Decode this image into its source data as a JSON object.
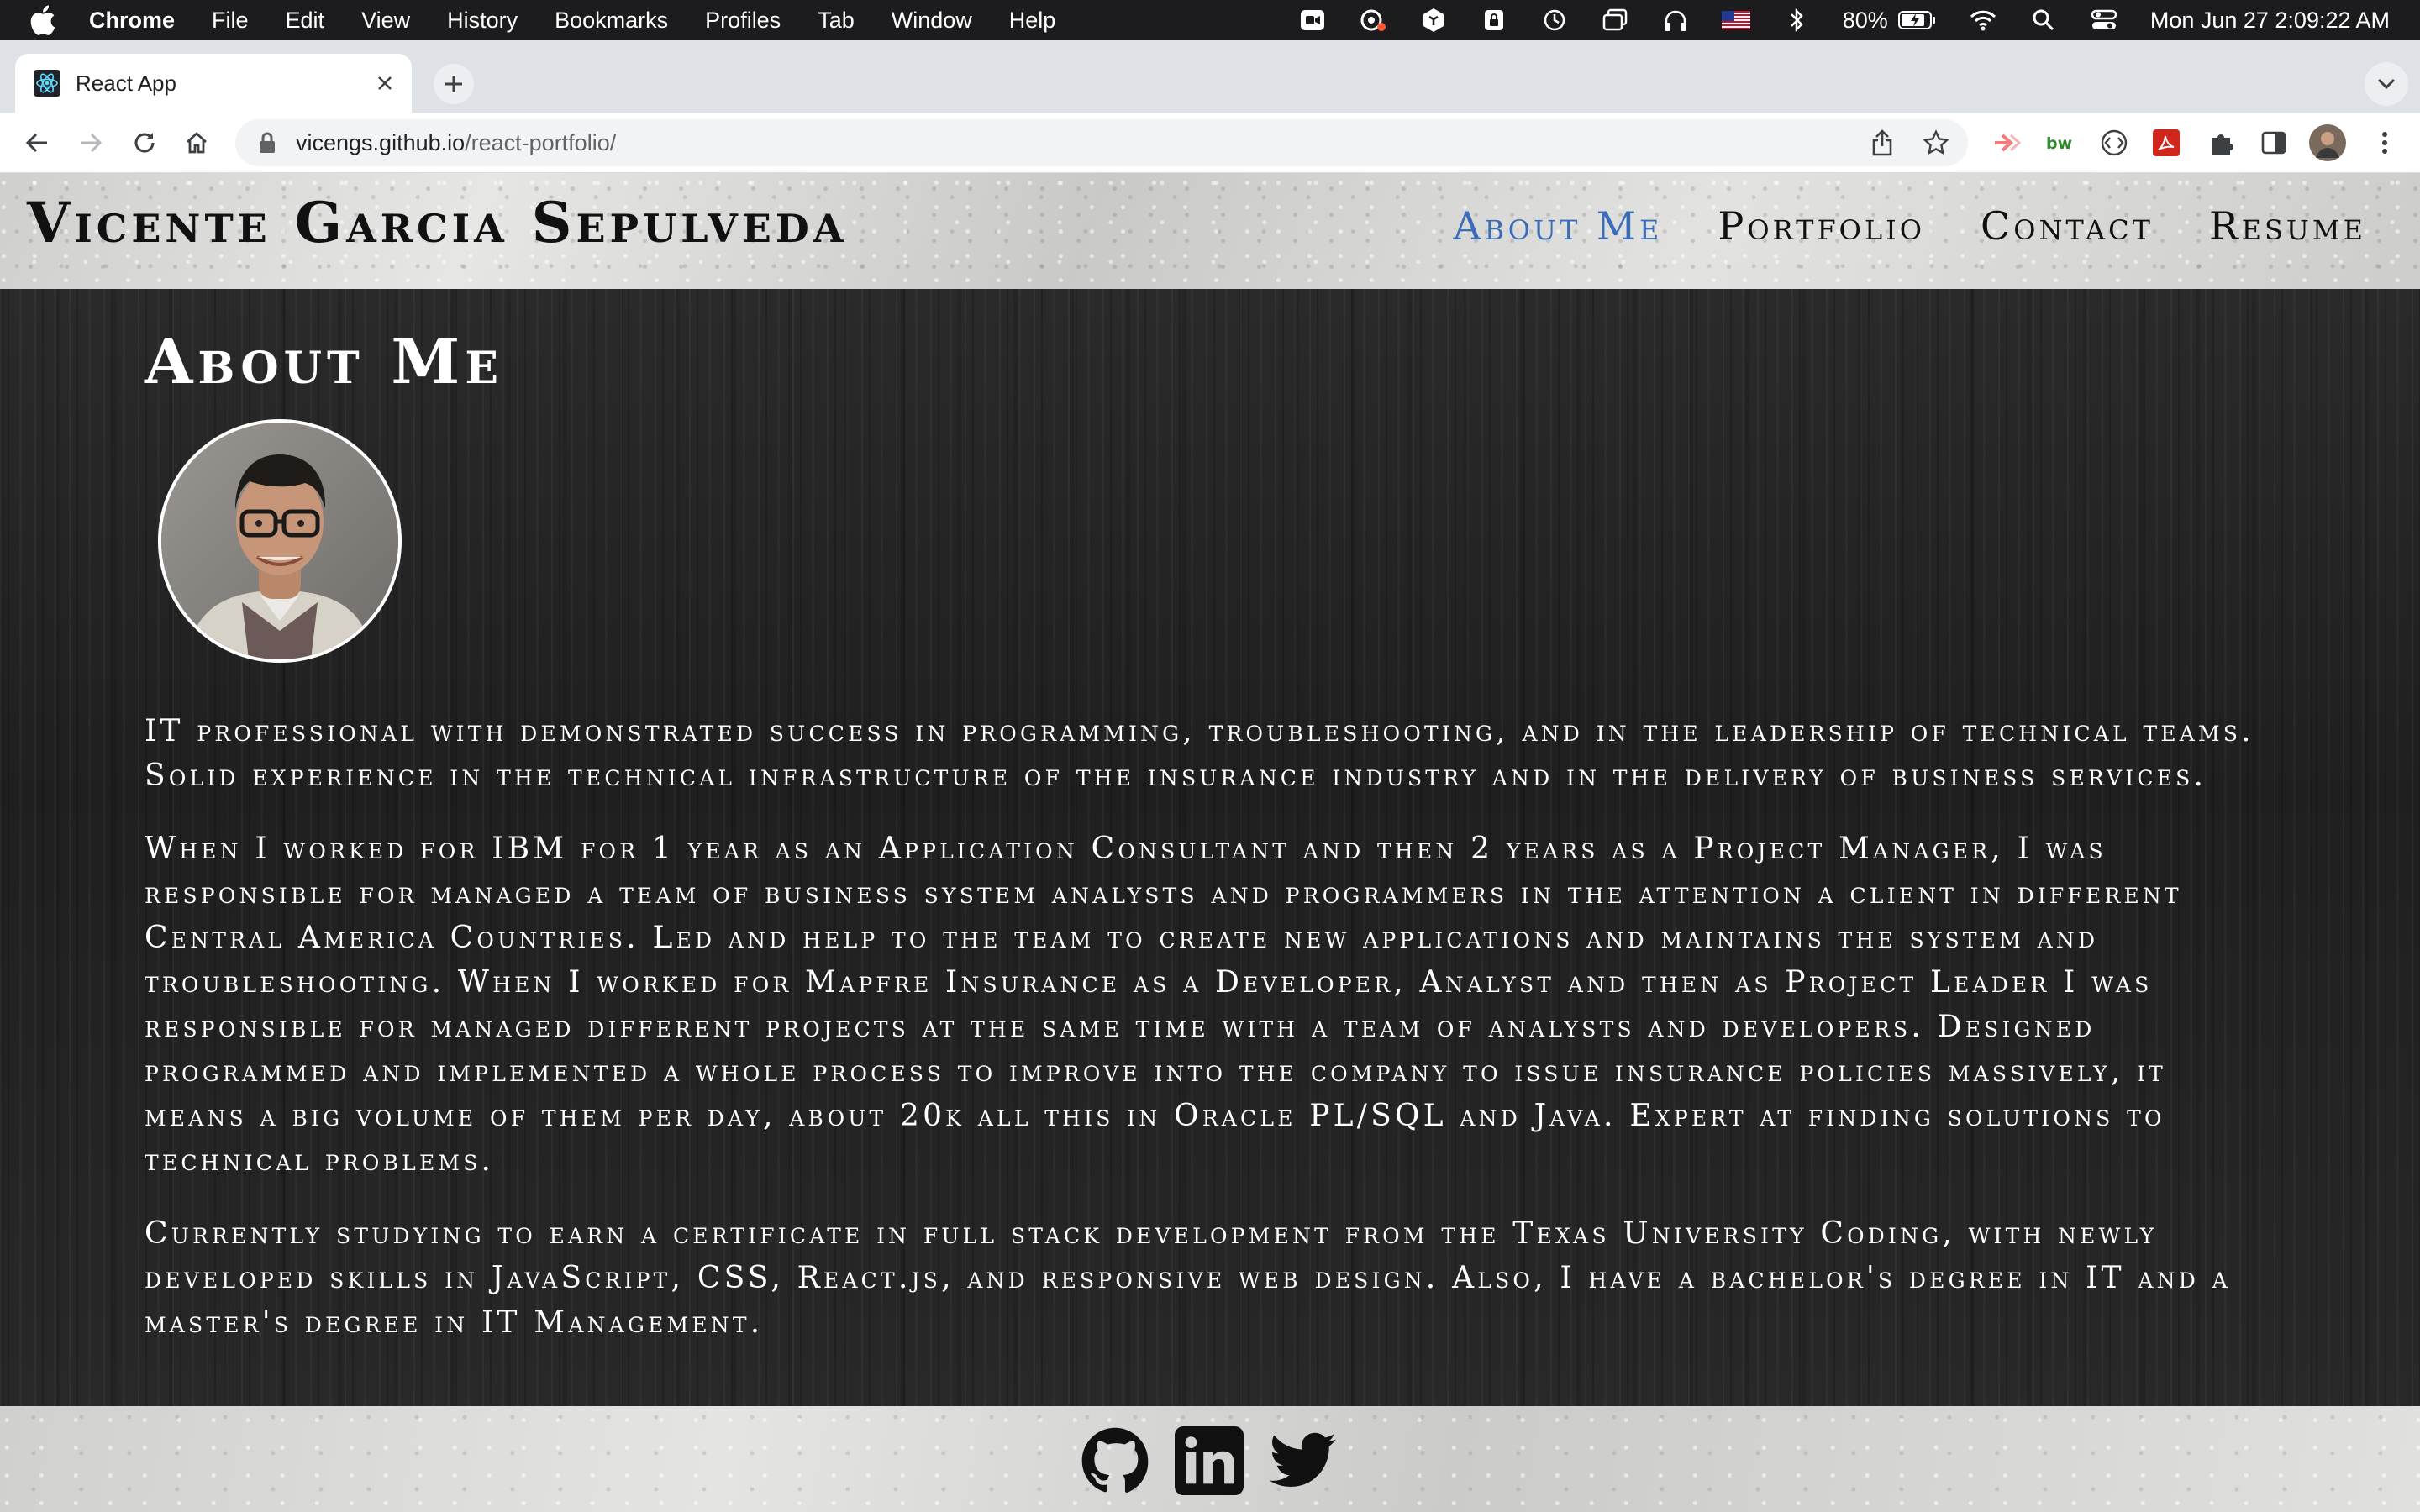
{
  "menubar": {
    "app_name": "Chrome",
    "items": [
      "File",
      "Edit",
      "View",
      "History",
      "Bookmarks",
      "Profiles",
      "Tab",
      "Window",
      "Help"
    ],
    "battery": "80%",
    "clock": "Mon Jun 27  2:09:22 AM"
  },
  "browser": {
    "tab_title": "React App",
    "url_host": "vicengs.github.io",
    "url_path": "/react-portfolio/"
  },
  "header": {
    "site_title": "Vicente Garcia Sepulveda",
    "nav": [
      {
        "label": "About Me",
        "active": true
      },
      {
        "label": "Portfolio",
        "active": false
      },
      {
        "label": "Contact",
        "active": false
      },
      {
        "label": "Resume",
        "active": false
      }
    ],
    "active_color": "#3b6cb8"
  },
  "about": {
    "title": "About Me",
    "paragraphs": [
      "IT professional with demonstrated success in programming, troubleshooting, and in the leadership of technical teams. Solid experience in the technical infrastructure of the insurance industry and in the delivery of business services.",
      "When I worked for IBM for 1 year as an Application Consultant and then 2 years as a Project Manager, I was responsible for managed a team of business system analysts and programmers in the attention a client in different Central America Countries. Led and help to the team to create new applications and maintains the system and troubleshooting. When I worked for Mapfre Insurance as a Developer, Analyst and then as Project Leader I was responsible for managed different projects at the same time with a team of analysts and developers. Designed programmed and implemented a whole process to improve into the company to issue insurance policies massively, it means a big volume of them per day, about 20k all this in Oracle PL/SQL and Java. Expert at finding solutions to technical problems.",
      "Currently studying to earn a certificate in full stack development from the Texas University Coding, with newly developed skills in JavaScript, CSS, React.js, and responsive web design. Also, I have a bachelor's degree in IT and a master's degree in IT Management."
    ]
  },
  "footer": {
    "social": [
      "github-icon",
      "linkedin-icon",
      "twitter-icon"
    ]
  }
}
